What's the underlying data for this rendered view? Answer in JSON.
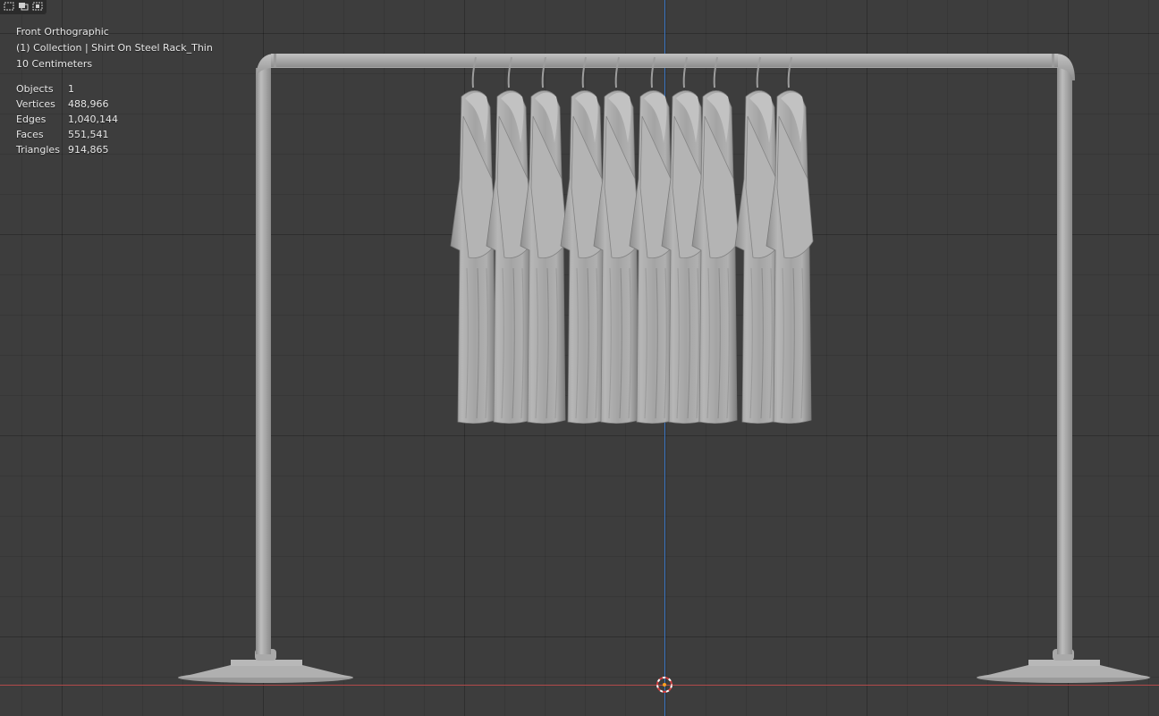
{
  "viewport": {
    "view_name": "Front Orthographic",
    "collection": "(1) Collection | Shirt On Steel Rack_Thin",
    "scale": "10 Centimeters"
  },
  "stats": [
    {
      "label": "Objects",
      "value": "1"
    },
    {
      "label": "Vertices",
      "value": "488,966"
    },
    {
      "label": "Edges",
      "value": "1,040,144"
    },
    {
      "label": "Faces",
      "value": "551,541"
    },
    {
      "label": "Triangles",
      "value": "914,865"
    }
  ],
  "header_tools": [
    {
      "icon": "select-box-icon"
    },
    {
      "icon": "select-extend-icon"
    },
    {
      "icon": "select-subtract-icon"
    }
  ],
  "colors": {
    "background": "#3d3d3d",
    "axis_z": "#3c77c4",
    "axis_x": "#b24a4a",
    "model": "#a8a8a8"
  }
}
